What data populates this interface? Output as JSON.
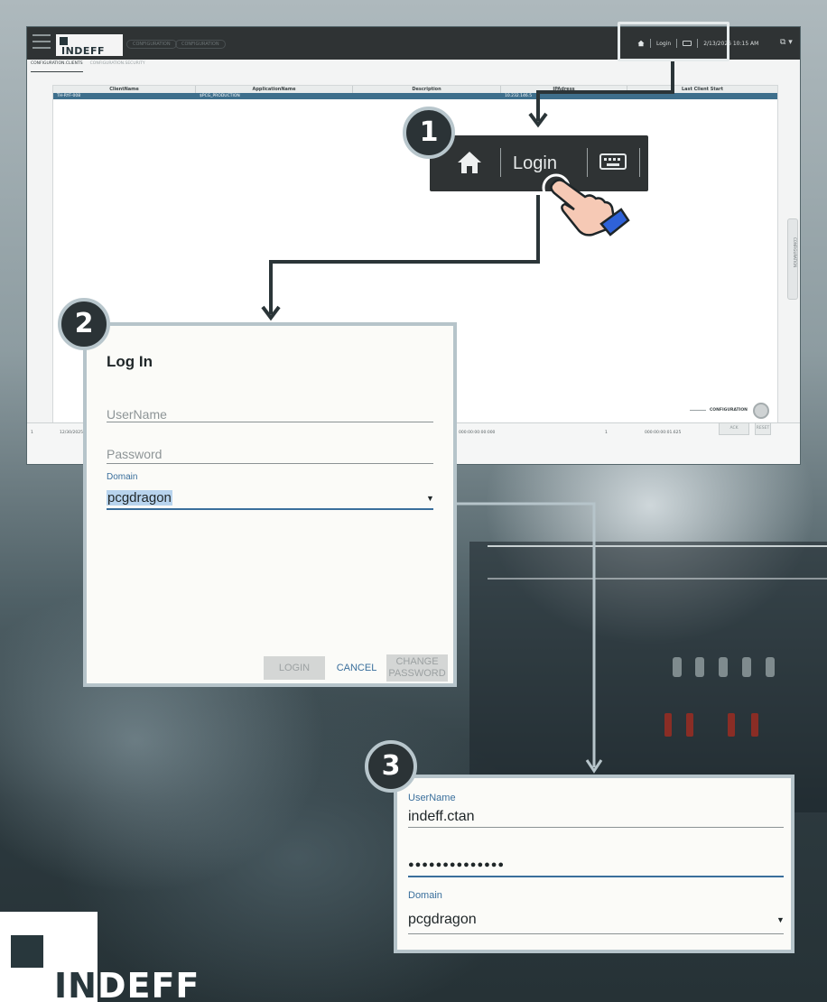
{
  "app": {
    "logo_text": "INDEFF",
    "breadcrumbs": [
      "CONFIGURATION",
      "CONFIGURATION"
    ],
    "status_bar": {
      "login_label": "Login",
      "datetime": "2/13/2026 10:15 AM"
    },
    "tabs": [
      "CONFIGURATION.CLIENTS",
      "CONFIGURATION.SECURITY"
    ],
    "grid": {
      "columns": [
        "ClientName",
        "ApplicationName",
        "Description",
        "IPAdress",
        "Last Client Start"
      ],
      "rows": [
        [
          "TH-RYF-008",
          "$PCG_PRODUCTION",
          "",
          "10.232.146.5",
          ""
        ]
      ]
    },
    "side_tab_label": "CONFIGURATION",
    "bottom_strip": {
      "cells": [
        "1",
        "12/30/2025",
        "000:00:00:00:000",
        "1",
        "000:00:00:01.625"
      ]
    },
    "config_panel": {
      "label": "CONFIGURATION",
      "ack_label": "ACK",
      "reset_label": "RESET"
    }
  },
  "callout1": {
    "step": "1",
    "login_label": "Login"
  },
  "login_dialog": {
    "step": "2",
    "title": "Log In",
    "username_placeholder": "UserName",
    "password_placeholder": "Password",
    "domain_label": "Domain",
    "domain_value": "pcgdragon",
    "login_button": "LOGIN",
    "cancel_button": "CANCEL",
    "change_password_line1": "CHANGE",
    "change_password_line2": "PASSWORD"
  },
  "filled_dialog": {
    "step": "3",
    "username_label": "UserName",
    "username_value": "indeff.ctan",
    "password_value": "●●●●●●●●●●●●●●",
    "domain_label": "Domain",
    "domain_value": "pcgdragon"
  },
  "brand": {
    "logo_in": "IN",
    "logo_deff": "DEFF"
  },
  "colors": {
    "accent_blue": "#3a6f9c",
    "topbar": "#2f3334",
    "badge_border": "#b8c6cc",
    "selection": "#3e6f8c"
  },
  "icons": [
    "hamburger-icon",
    "home-icon",
    "keyboard-icon",
    "pointing-hand-icon",
    "chevron-down-icon"
  ]
}
